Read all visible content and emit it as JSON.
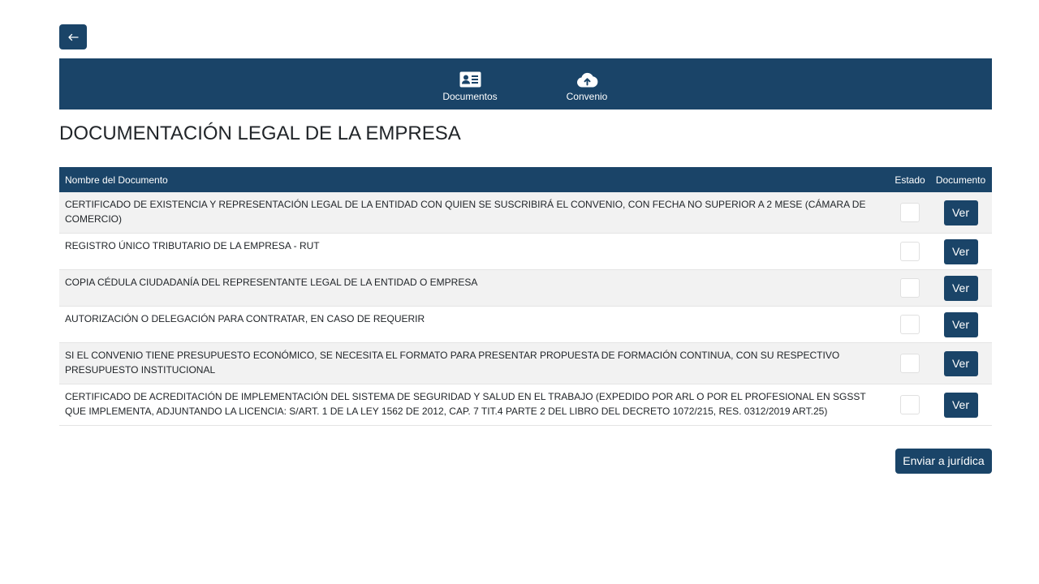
{
  "nav": {
    "back_icon": "arrow-left-icon",
    "items": [
      {
        "label": "Documentos",
        "icon": "id-card-icon"
      },
      {
        "label": "Convenio",
        "icon": "cloud-upload-icon"
      }
    ]
  },
  "title": "DOCUMENTACIÓN LEGAL DE LA EMPRESA",
  "table": {
    "headers": {
      "name": "Nombre del Documento",
      "estado": "Estado",
      "documento": "Documento"
    },
    "rows": [
      {
        "name": "CERTIFICADO DE EXISTENCIA Y REPRESENTACIÓN LEGAL DE LA ENTIDAD CON QUIEN SE SUSCRIBIRÁ EL CONVENIO, CON FECHA NO SUPERIOR A 2 MESE (CÁMARA DE COMERCIO)",
        "action": "Ver"
      },
      {
        "name": "REGISTRO ÚNICO TRIBUTARIO DE LA EMPRESA - RUT",
        "action": "Ver"
      },
      {
        "name": "COPIA CÉDULA CIUDADANÍA DEL REPRESENTANTE LEGAL DE LA ENTIDAD O EMPRESA",
        "action": "Ver"
      },
      {
        "name": "AUTORIZACIÓN O DELEGACIÓN PARA CONTRATAR, EN CASO DE REQUERIR",
        "action": "Ver"
      },
      {
        "name": "SI EL CONVENIO TIENE PRESUPUESTO ECONÓMICO, SE NECESITA EL FORMATO PARA PRESENTAR PROPUESTA DE FORMACIÓN CONTINUA, CON SU RESPECTIVO PRESUPUESTO INSTITUCIONAL",
        "action": "Ver"
      },
      {
        "name": "CERTIFICADO DE ACREDITACIÓN DE IMPLEMENTACIÓN DEL SISTEMA DE SEGURIDAD Y SALUD EN EL TRABAJO (EXPEDIDO POR ARL O POR EL PROFESIONAL EN SGSST QUE IMPLEMENTA, ADJUNTANDO LA LICENCIA: S/ART. 1 DE LA LEY 1562 DE 2012, CAP. 7 TIT.4 PARTE 2 DEL LIBRO DEL DECRETO 1072/215, RES. 0312/2019 ART.25)",
        "action": "Ver"
      }
    ]
  },
  "submit_label": "Enviar a jurídica",
  "colors": {
    "primary": "#1a4468",
    "row_alt": "#f2f2f2"
  }
}
